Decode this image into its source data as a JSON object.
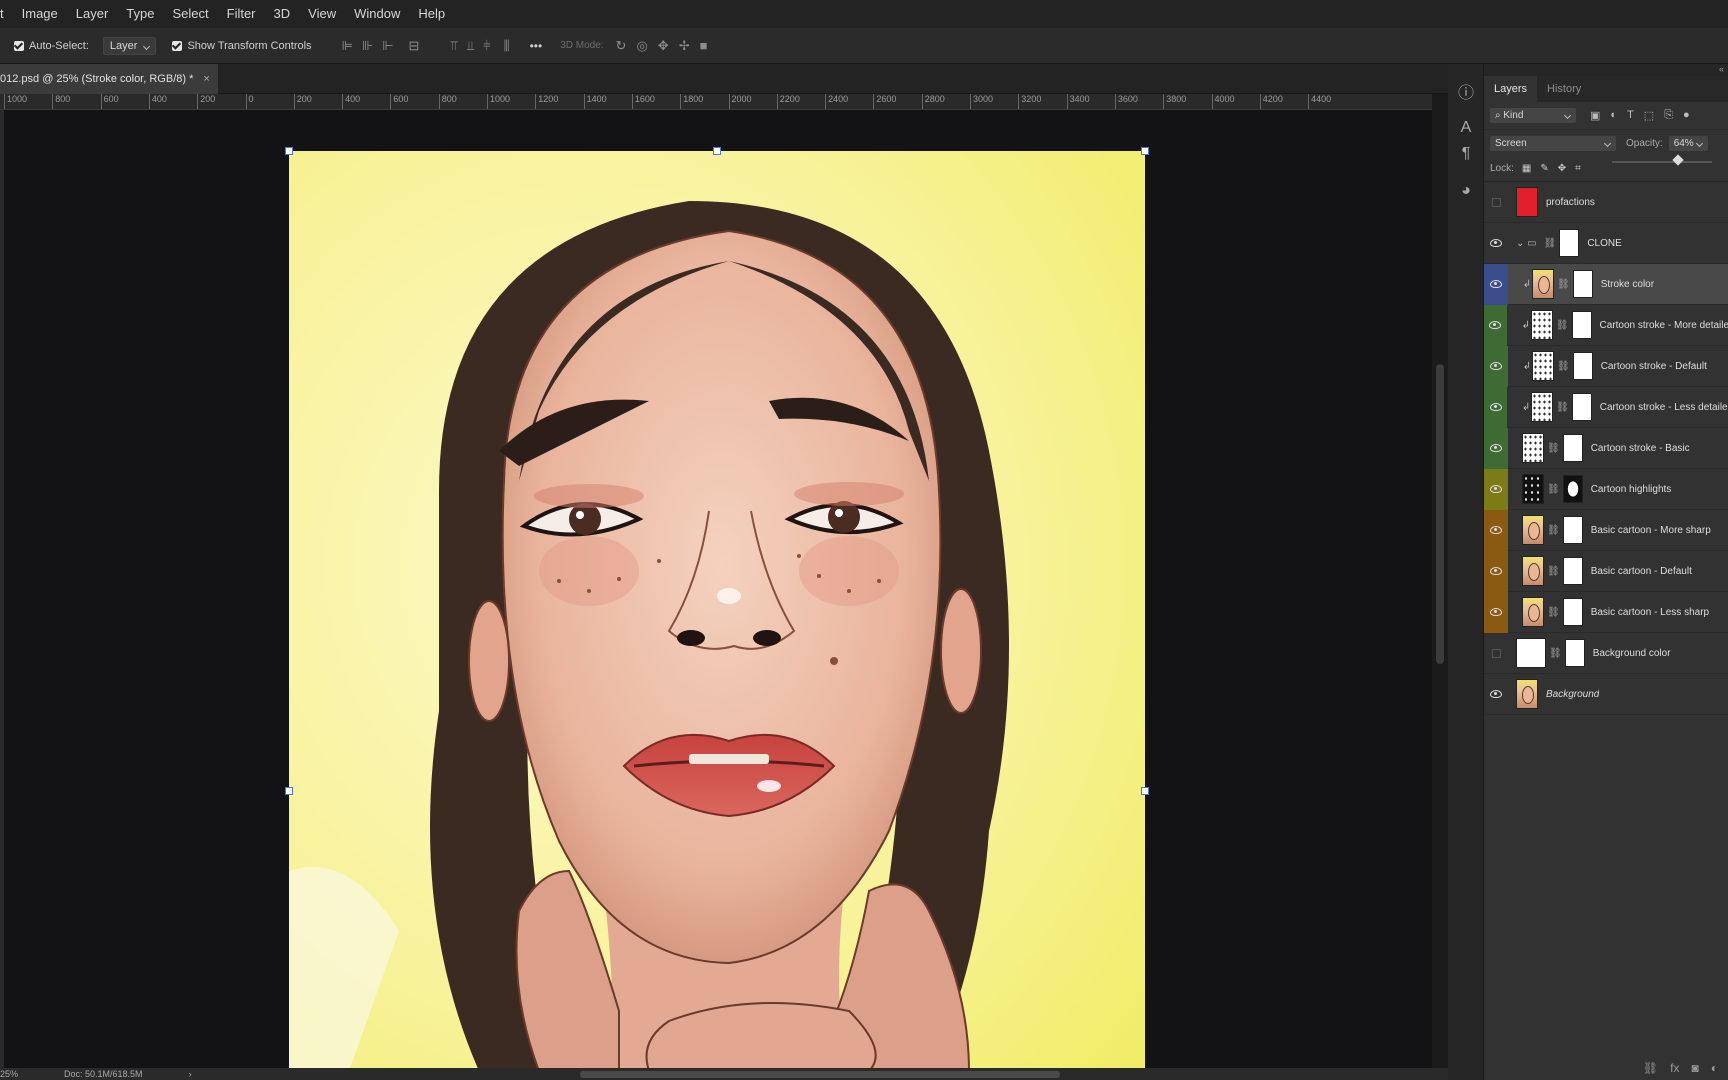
{
  "menu": [
    "t",
    "Image",
    "Layer",
    "Type",
    "Select",
    "Filter",
    "3D",
    "View",
    "Window",
    "Help"
  ],
  "options": {
    "auto_select_label": "Auto-Select:",
    "auto_select_value": "Layer",
    "show_transform_label": "Show Transform Controls",
    "mode_3d_label": "3D Mode:",
    "more_label": "•••"
  },
  "document_tab": {
    "title": "012.psd @ 25% (Stroke color, RGB/8) *",
    "close": "×"
  },
  "ruler_ticks": [
    "1000",
    "800",
    "600",
    "400",
    "200",
    "0",
    "200",
    "400",
    "600",
    "800",
    "1000",
    "1200",
    "1400",
    "1600",
    "1800",
    "2000",
    "2200",
    "2400",
    "2600",
    "2800",
    "3000",
    "3200",
    "3400",
    "3600",
    "3800",
    "4000",
    "4200",
    "4400"
  ],
  "status": {
    "zoom": "25%",
    "doc_size": "Doc: 50.1M/618.5M",
    "arrow": "›"
  },
  "panel": {
    "tabs": [
      "Layers",
      "History"
    ],
    "filter_kind": "Kind",
    "blend_mode": "Screen",
    "opacity_label": "Opacity:",
    "opacity_value": "64%",
    "lock_label": "Lock:",
    "collapse": "«"
  },
  "layers": [
    {
      "name": "profactions",
      "visible": false,
      "thumb": "red",
      "mask": false,
      "group": false,
      "clip": false,
      "indent": 0
    },
    {
      "name": "CLONE",
      "visible": true,
      "thumb": "folder",
      "mask": true,
      "group": true,
      "clip": false,
      "indent": 0
    },
    {
      "name": "Stroke color",
      "visible": true,
      "thumb": "face",
      "mask": true,
      "group": false,
      "clip": true,
      "indent": 1,
      "selected": true
    },
    {
      "name": "Cartoon stroke - More detailed",
      "visible": true,
      "thumb": "sketch",
      "mask": true,
      "group": false,
      "clip": true,
      "indent": 1
    },
    {
      "name": "Cartoon stroke - Default",
      "visible": true,
      "thumb": "sketch",
      "mask": true,
      "group": false,
      "clip": true,
      "indent": 1
    },
    {
      "name": "Cartoon stroke - Less detailed",
      "visible": true,
      "thumb": "sketch",
      "mask": true,
      "group": false,
      "clip": true,
      "indent": 1
    },
    {
      "name": "Cartoon stroke - Basic",
      "visible": true,
      "thumb": "sketch",
      "mask": true,
      "group": false,
      "clip": false,
      "indent": 1
    },
    {
      "name": "Cartoon highlights",
      "visible": true,
      "thumb": "dark",
      "mask": true,
      "group": false,
      "clip": false,
      "indent": 1
    },
    {
      "name": "Basic cartoon - More sharp",
      "visible": true,
      "thumb": "face",
      "mask": true,
      "group": false,
      "clip": false,
      "indent": 1
    },
    {
      "name": "Basic cartoon - Default",
      "visible": true,
      "thumb": "face",
      "mask": true,
      "group": false,
      "clip": false,
      "indent": 1
    },
    {
      "name": "Basic cartoon - Less sharp",
      "visible": true,
      "thumb": "face",
      "mask": true,
      "group": false,
      "clip": false,
      "indent": 1
    },
    {
      "name": "Background color",
      "visible": false,
      "thumb": "white",
      "mask": true,
      "group": false,
      "clip": false,
      "indent": 0
    },
    {
      "name": "Background",
      "visible": true,
      "thumb": "face",
      "mask": false,
      "group": false,
      "clip": false,
      "indent": 0
    }
  ],
  "layer_colors": [
    "",
    "",
    "#3b4d8a",
    "#3e6b33",
    "#3e6b33",
    "#3e6b33",
    "#3e6b33",
    "#7d7a18",
    "#8a5a12",
    "#8a5a12",
    "#8a5a12",
    "",
    ""
  ],
  "icons": {
    "info": "info-icon",
    "character": "character-icon",
    "paragraph": "paragraph-icon",
    "alien": "alien-icon"
  }
}
